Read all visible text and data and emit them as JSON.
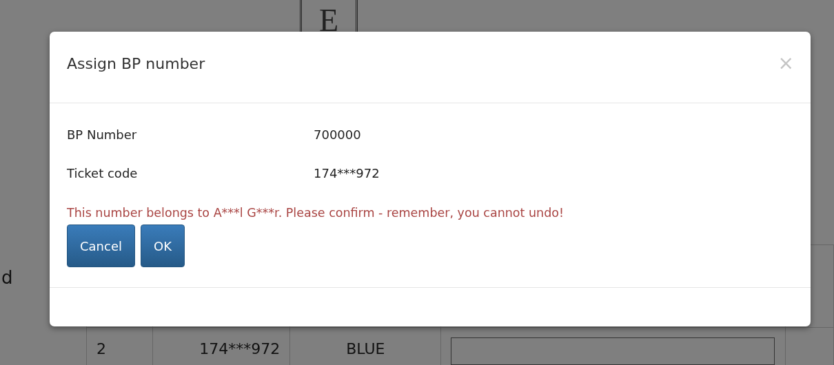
{
  "page": {
    "logo_letter": "E",
    "side_text": "d",
    "table": {
      "rows": [
        {
          "cells": [
            "2",
            "174***972",
            "BLUE"
          ]
        }
      ]
    }
  },
  "dialog": {
    "title": "Assign BP number",
    "close": "×",
    "fields": [
      {
        "label": "BP Number",
        "value": "700000"
      },
      {
        "label": "Ticket code",
        "value": "174***972"
      }
    ],
    "message": "This number belongs to A***l G***r. Please confirm - remember, you cannot undo!",
    "buttons": [
      {
        "label": "Cancel"
      },
      {
        "label": "OK"
      }
    ]
  }
}
